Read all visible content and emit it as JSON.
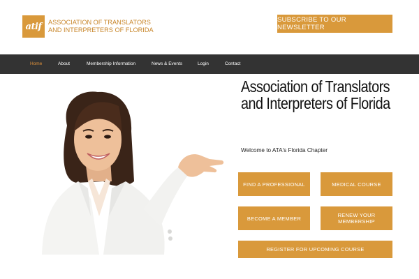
{
  "header": {
    "logo_mark": "atif",
    "logo_line1": "Association of Translators",
    "logo_line2": "and Interpreters of Florida",
    "subscribe_label": "SUBSCRIBE TO OUR NEWSLETTER"
  },
  "nav": {
    "items": [
      {
        "label": "Home",
        "active": true
      },
      {
        "label": "About"
      },
      {
        "label": "Membership Information"
      },
      {
        "label": "News & Events"
      },
      {
        "label": "Login"
      },
      {
        "label": "Contact"
      }
    ]
  },
  "hero": {
    "title": "Association of Translators and Interpreters of Florida",
    "subtitle": "Welcome to ATA's Florida Chapter"
  },
  "buttons": {
    "find_professional": "FIND A PROFESSIONAL",
    "medical_course": "MEDICAL COURSE",
    "become_member": "BECOME A MEMBER",
    "renew_membership": "RENEW YOUR MEMBERSHIP",
    "register_course": "REGISTER FOR UPCOMING COURSE"
  },
  "colors": {
    "accent": "#d9993b",
    "nav_bg": "#333333",
    "nav_active": "#e0913a"
  }
}
